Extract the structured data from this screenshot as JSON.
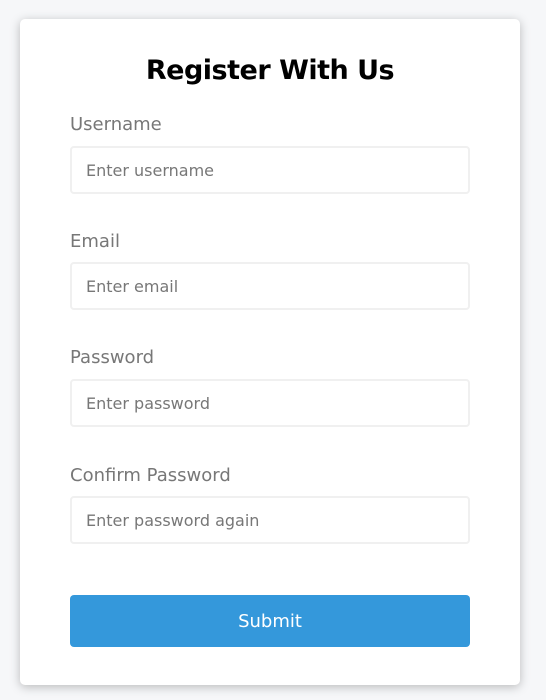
{
  "title": "Register With Us",
  "fields": [
    {
      "label": "Username",
      "placeholder": "Enter username",
      "value": ""
    },
    {
      "label": "Email",
      "placeholder": "Enter email",
      "value": ""
    },
    {
      "label": "Password",
      "placeholder": "Enter password",
      "value": ""
    },
    {
      "label": "Confirm Password",
      "placeholder": "Enter password again",
      "value": ""
    }
  ],
  "submit_label": "Submit",
  "colors": {
    "button": "#3498db",
    "label": "#777777"
  }
}
